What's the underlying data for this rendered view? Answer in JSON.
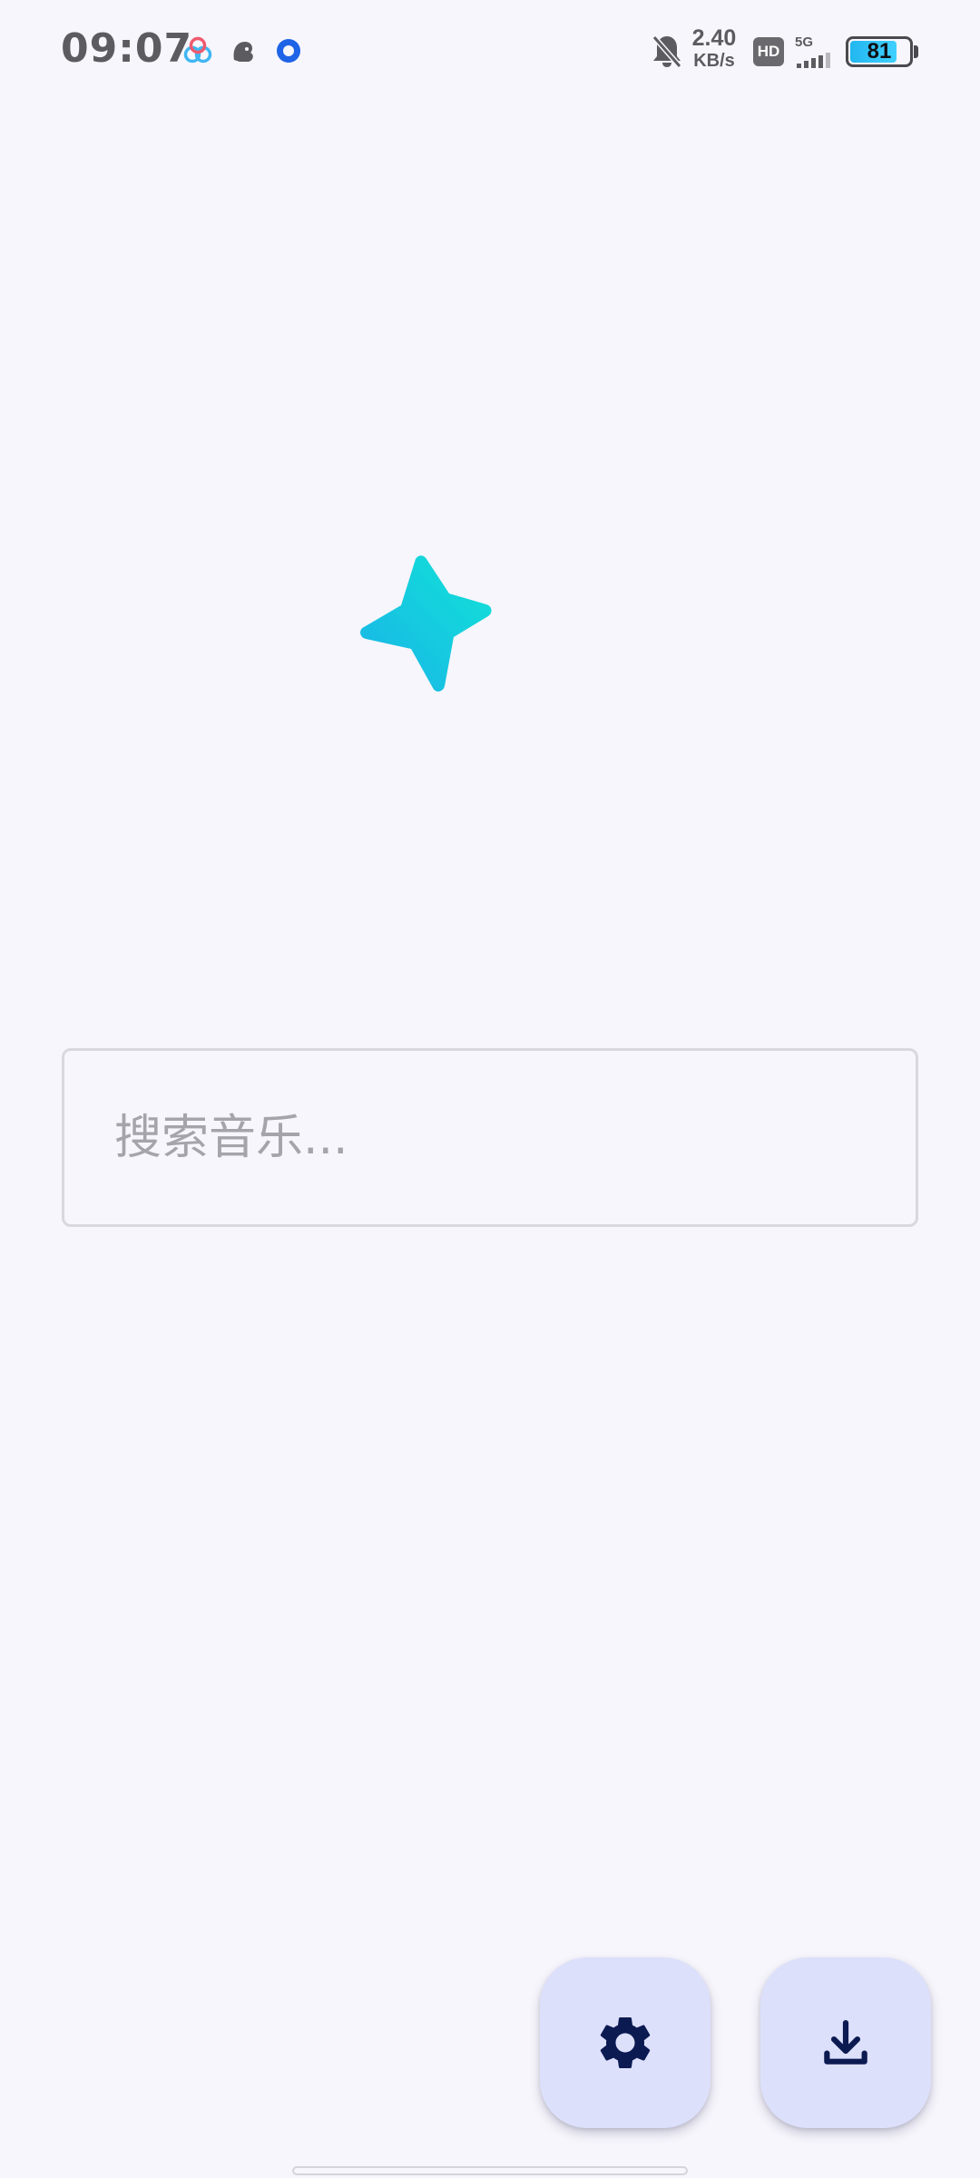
{
  "status_bar": {
    "time": "09:07",
    "net_speed_value": "2.40",
    "net_speed_unit": "KB/s",
    "hd_label": "HD",
    "network_type": "5G",
    "battery_level": "81",
    "battery_fraction": 0.81
  },
  "search": {
    "placeholder": "搜索音乐..."
  },
  "icons": {
    "logo": "sparkle-icon",
    "settings": "gear-icon",
    "download": "download-icon"
  },
  "colors": {
    "background": "#f7f6fc",
    "fab_background": "#dde0fb",
    "fab_icon": "#0c1a52",
    "logo_gradient_start": "#19b3e8",
    "logo_gradient_end": "#12e3d6"
  }
}
